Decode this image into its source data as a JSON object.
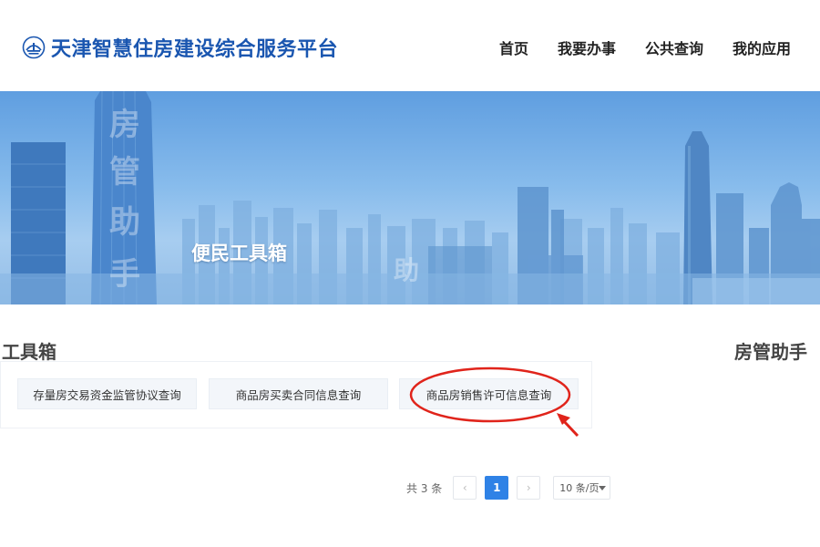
{
  "header": {
    "site_title": "天津智慧住房建设综合服务平台",
    "nav": [
      "首页",
      "我要办事",
      "公共查询",
      "我的应用"
    ]
  },
  "banner": {
    "title": "便民工具箱",
    "watermark_chars": [
      "房",
      "管",
      "助",
      "手",
      "助"
    ]
  },
  "section": {
    "toolbox_title": "工具箱",
    "assistant_title": "房管助手"
  },
  "tools": [
    "存量房交易资金监管协议查询",
    "商品房买卖合同信息查询",
    "商品房销售许可信息查询"
  ],
  "pagination": {
    "total": "共 3 条",
    "current_page": "1",
    "page_size": "10 条/页",
    "prev_icon": "chevron-left-icon",
    "next_icon": "chevron-right-icon"
  },
  "colors": {
    "brand": "#1a56b0",
    "accent": "#2f82e6",
    "annotation": "#e0241b"
  }
}
